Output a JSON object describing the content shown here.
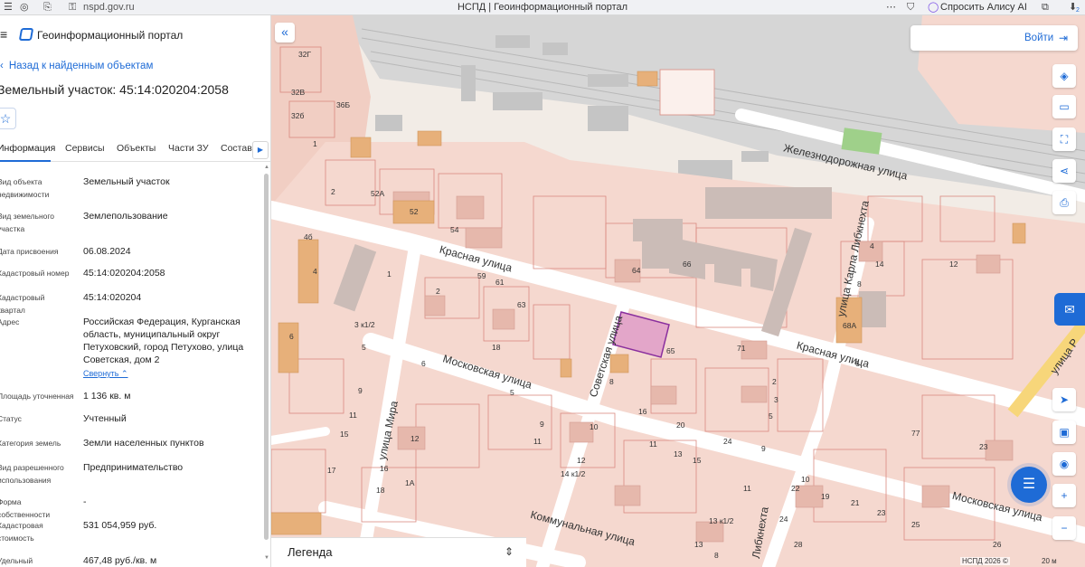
{
  "browser": {
    "url": "nspd.gov.ru",
    "title": "НСПД | Геоинформационный портал",
    "alice_label": "Спросить Алису AI",
    "notif_count": "2"
  },
  "panel": {
    "app_title": "Геоинформационный портал",
    "back_label": "Назад к найденным объектам",
    "parcel_title": "Земельный участок: 45:14:020204:2058",
    "tabs": [
      "Информация",
      "Сервисы",
      "Объекты",
      "Части ЗУ",
      "Состав"
    ],
    "active_tab": "Информация",
    "collapse_label": "Свернуть",
    "fields": [
      {
        "label": "Вид объекта недвижимости",
        "value": "Земельный участок"
      },
      {
        "label": "Вид земельного участка",
        "value": "Землепользование"
      },
      {
        "label": "Дата присвоения",
        "value": "06.08.2024"
      },
      {
        "label": "Кадастровый номер",
        "value": "45:14:020204:2058"
      },
      {
        "label": "Кадастровый квартал",
        "value": "45:14:020204"
      },
      {
        "label": "Адрес",
        "value": "Российская Федерация, Курганская область, муниципальный округ Петуховский, город Петухово, улица Советская, дом 2"
      },
      {
        "label": "Площадь уточненная",
        "value": "1 136 кв. м"
      },
      {
        "label": "Статус",
        "value": "Учтенный"
      },
      {
        "label": "Категория земель",
        "value": "Земли населенных пунктов"
      },
      {
        "label": "Вид разрешенного использования",
        "value": "Предпринимательство"
      },
      {
        "label": "Форма собственности",
        "value": "-"
      },
      {
        "label": "Кадастровая стоимость",
        "value": "531 054,959 руб."
      },
      {
        "label": "Удельный показатель",
        "value": "467,48 руб./кв. м"
      }
    ]
  },
  "map": {
    "login_label": "Войти",
    "legend_label": "Легенда",
    "copyright": "НСПД 2026 ©",
    "scale_label": "20 м",
    "streets": [
      "Железнодорожная улица",
      "Красная улица",
      "Красная улица",
      "Московская улица",
      "Московская улица",
      "Советская улица",
      "улица Мира",
      "улица Карла Либкнехта",
      "Коммунальная улица",
      "Либкнехта",
      "улица Р"
    ],
    "numbers": [
      "32Г",
      "32В",
      "32б",
      "36Б",
      "1",
      "2",
      "52А",
      "52",
      "54",
      "4б",
      "4",
      "1",
      "59",
      "61",
      "63",
      "64",
      "66",
      "2",
      "18",
      "3 к1/2",
      "5",
      "6",
      "6",
      "9",
      "11",
      "15",
      "17",
      "5",
      "9",
      "11",
      "12",
      "14 к1/2",
      "10",
      "11",
      "12",
      "13",
      "15",
      "16",
      "20",
      "24",
      "1А",
      "16",
      "18",
      "8",
      "65",
      "71",
      "2",
      "3",
      "5",
      "9",
      "10",
      "6",
      "68А",
      "4",
      "8",
      "14",
      "12",
      "23",
      "77",
      "22",
      "19",
      "21",
      "23",
      "26",
      "25",
      "24",
      "28",
      "13",
      "8",
      "11",
      "13 к1/2"
    ]
  }
}
